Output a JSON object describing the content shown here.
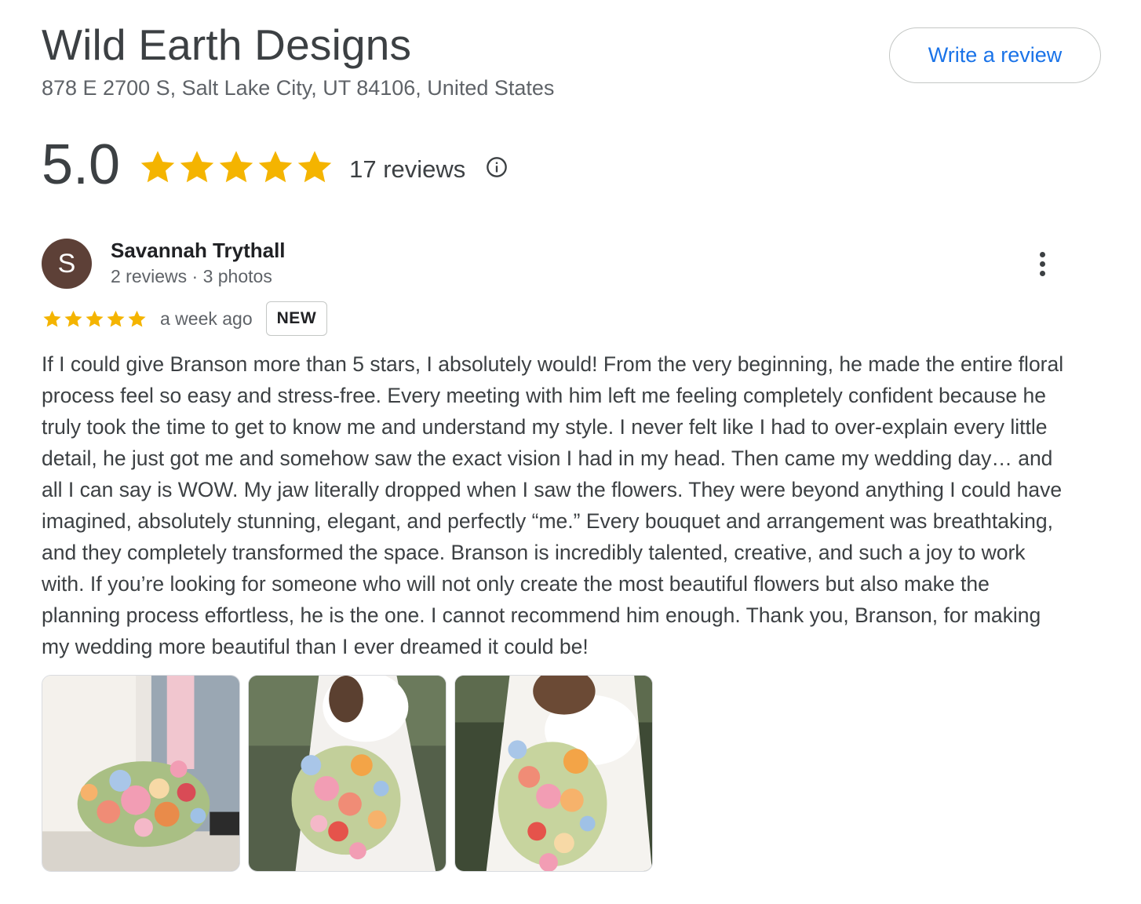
{
  "business": {
    "name": "Wild Earth Designs",
    "address": "878 E 2700 S, Salt Lake City, UT 84106, United States",
    "write_review_label": "Write a review"
  },
  "rating": {
    "value": "5.0",
    "stars": 5,
    "review_count_label": "17 reviews",
    "info_icon": "info-icon"
  },
  "review": {
    "avatar_letter": "S",
    "reviewer_name": "Savannah Trythall",
    "reviewer_meta": "2 reviews · 3 photos",
    "stars": 5,
    "date": "a week ago",
    "badge": "NEW",
    "text": "If I could give Branson more than 5 stars, I absolutely would! From the very beginning, he made the entire floral process feel so easy and stress-free. Every meeting with him left me feeling completely confident because he truly took the time to get to know me and understand my style. I never felt like I had to over-explain every little detail, he just got me and somehow saw the exact vision I had in my head. Then came my wedding day… and all I can say is WOW. My jaw literally dropped when I saw the flowers. They were beyond anything I could have imagined, absolutely stunning, elegant, and perfectly “me.” Every bouquet and arrangement was breathtaking, and they completely transformed the space. Branson is incredibly talented, creative, and such a joy to work with. If you’re looking for someone who will not only create the most beautiful flowers but also make the planning process effortless, he is the one. I cannot recommend him enough. Thank you, Branson, for making my wedding more beautiful than I ever dreamed it could be!",
    "photos": [
      "bridal-bouquet-photo",
      "bridal-bouquet-photo",
      "bridal-bouquet-photo"
    ]
  },
  "colors": {
    "star": "#f4b400",
    "accent": "#1a73e8",
    "avatar": "#5d4037"
  }
}
